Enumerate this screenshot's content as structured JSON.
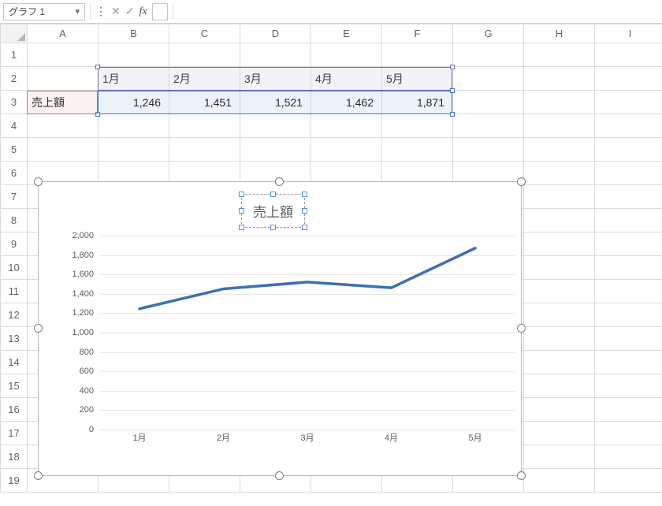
{
  "formula_bar": {
    "name_box": "グラフ 1",
    "fx_value": ""
  },
  "columns": [
    "A",
    "B",
    "C",
    "D",
    "E",
    "F",
    "G",
    "H",
    "I"
  ],
  "rows": [
    "1",
    "2",
    "3",
    "4",
    "5",
    "6",
    "7",
    "8",
    "9",
    "10",
    "11",
    "12",
    "13",
    "14",
    "15",
    "16",
    "17",
    "18",
    "19"
  ],
  "cells": {
    "A3": "売上額",
    "B2": "1月",
    "C2": "2月",
    "D2": "3月",
    "E2": "4月",
    "F2": "5月",
    "B3": "1,246",
    "C3": "1,451",
    "D3": "1,521",
    "E3": "1,462",
    "F3": "1,871"
  },
  "chart_data": {
    "type": "line",
    "title": "売上額",
    "categories": [
      "1月",
      "2月",
      "3月",
      "4月",
      "5月"
    ],
    "series": [
      {
        "name": "売上額",
        "values": [
          1246,
          1451,
          1521,
          1462,
          1871
        ]
      }
    ],
    "xlabel": "",
    "ylabel": "",
    "ylim": [
      0,
      2000
    ],
    "y_ticks": [
      0,
      200,
      400,
      600,
      800,
      1000,
      1200,
      1400,
      1600,
      1800,
      2000
    ],
    "grid": true,
    "legend": false
  }
}
